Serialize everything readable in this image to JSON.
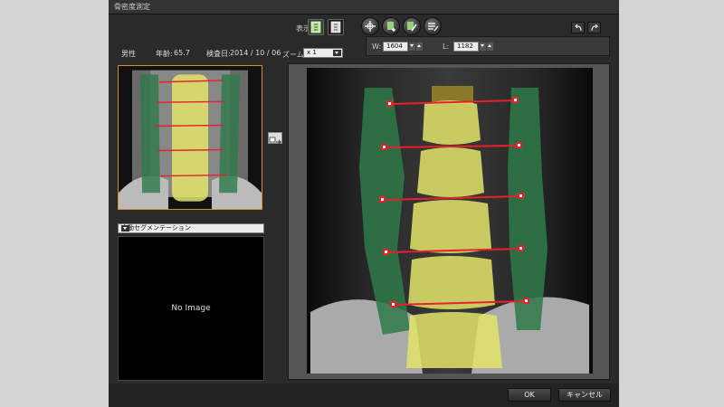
{
  "window": {
    "title": "骨密度測定"
  },
  "toolbar": {
    "display_label": "表示:",
    "zoom_label": "ズーム:",
    "zoom_value": "x 1"
  },
  "patient": {
    "gender": "男性",
    "age_label": "年齢:",
    "age": "65.7",
    "exam_date_label": "検査日:",
    "exam_date": "2014 / 10 / 06"
  },
  "window_level": {
    "w_label": "W:",
    "w_value": "1604",
    "l_label": "L:",
    "l_value": "1182"
  },
  "segmentation": {
    "selected": "自動セグメンテーション"
  },
  "secondary_image": {
    "placeholder": "No Image"
  },
  "footer": {
    "ok_label": "OK",
    "cancel_label": "キャンセル"
  },
  "colors": {
    "bone_region": "#e4e46a",
    "soft_tissue_region": "#2e7a4a",
    "measure_line": "#e8202a",
    "selected_border": "#d98c2b"
  },
  "icons": [
    "display-mode-1-icon",
    "display-mode-2-icon",
    "crosshair-icon",
    "add-roi-icon",
    "edit-roi-icon",
    "list-edit-icon",
    "undo-icon",
    "redo-icon",
    "transfer-icon"
  ]
}
